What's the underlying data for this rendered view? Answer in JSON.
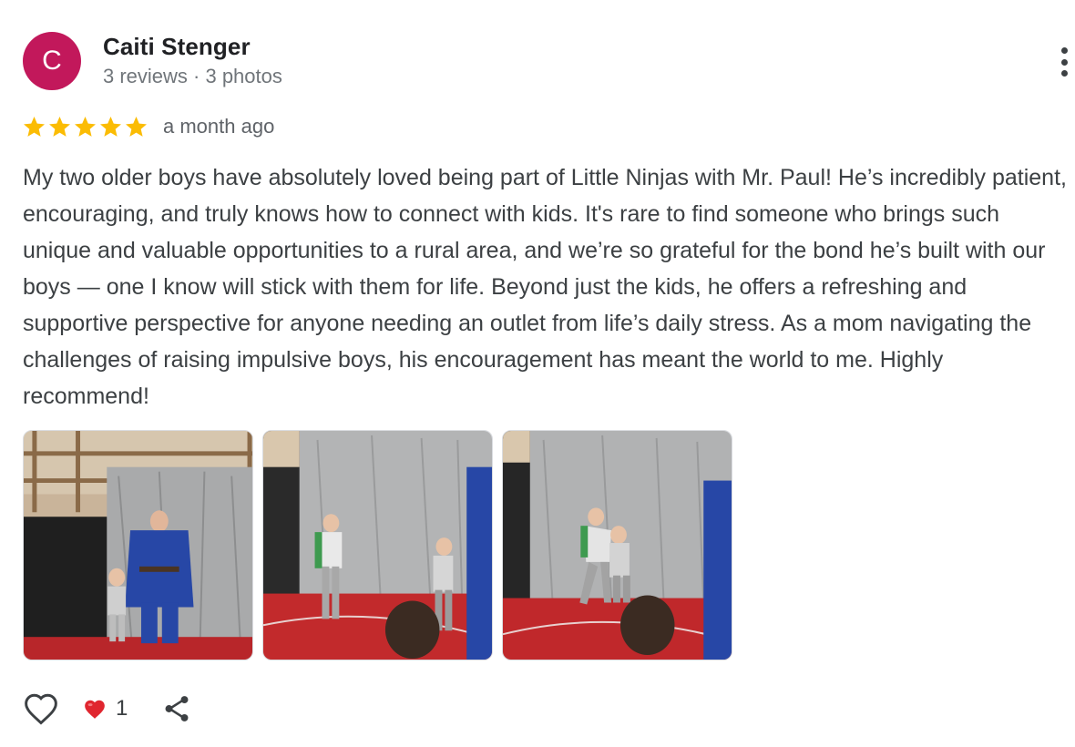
{
  "reviewer": {
    "initial": "C",
    "name": "Caiti Stenger",
    "meta": "3 reviews · 3 photos",
    "avatar_color": "#c2185b"
  },
  "rating": {
    "stars": 5,
    "max_stars": 5,
    "star_color": "#fbbc04",
    "time": "a month ago"
  },
  "review": {
    "text": "My two older boys have absolutely loved being part of Little Ninjas with Mr. Paul! He’s incredibly patient, encouraging, and truly knows how to connect with kids. It's rare to find someone who brings such unique and valuable opportunities to a rural area, and we’re so grateful for the bond he’s built with our boys — one I know will stick with them for life. Beyond just the kids, he offers a refreshing and supportive perspective for anyone needing an outlet from life’s daily stress. As a mom navigating the challenges of raising impulsive boys, his encouragement has meant the world to me. Highly recommend!"
  },
  "photos": [
    {
      "icon": "review-photo-1"
    },
    {
      "icon": "review-photo-2"
    },
    {
      "icon": "review-photo-3"
    }
  ],
  "actions": {
    "like_icon": "heart-outline-icon",
    "reaction_icon": "red-heart-icon",
    "reaction_count": "1",
    "share_icon": "share-icon",
    "menu_icon": "more-vertical-icon"
  }
}
